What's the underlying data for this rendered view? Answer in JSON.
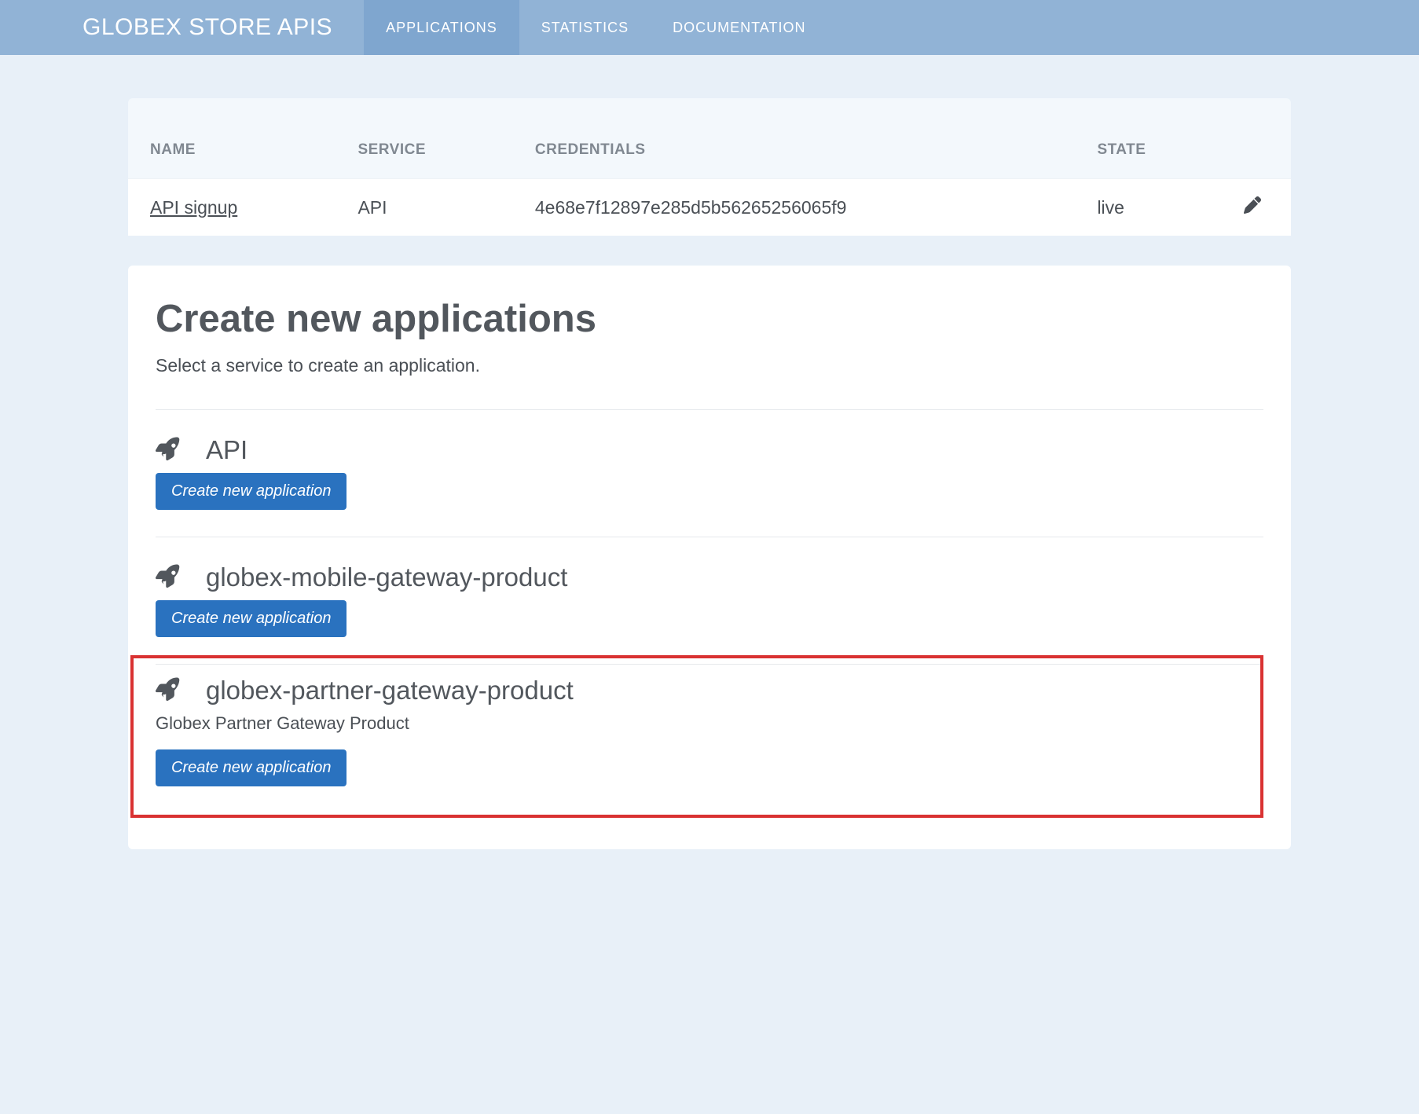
{
  "brand": "GLOBEX STORE APIS",
  "nav": {
    "tabs": [
      "APPLICATIONS",
      "STATISTICS",
      "DOCUMENTATION"
    ],
    "active": 0
  },
  "table": {
    "headers": {
      "name": "NAME",
      "service": "SERVICE",
      "credentials": "CREDENTIALS",
      "state": "STATE"
    },
    "rows": [
      {
        "name": "API signup",
        "service": "API",
        "credentials": "4e68e7f12897e285d5b56265256065f9",
        "state": "live"
      }
    ]
  },
  "create_section": {
    "title": "Create new applications",
    "subtitle": "Select a service to create an application.",
    "button_label": "Create new application",
    "services": [
      {
        "name": "API",
        "description": ""
      },
      {
        "name": "globex-mobile-gateway-product",
        "description": ""
      },
      {
        "name": "globex-partner-gateway-product",
        "description": "Globex Partner Gateway Product"
      }
    ]
  }
}
